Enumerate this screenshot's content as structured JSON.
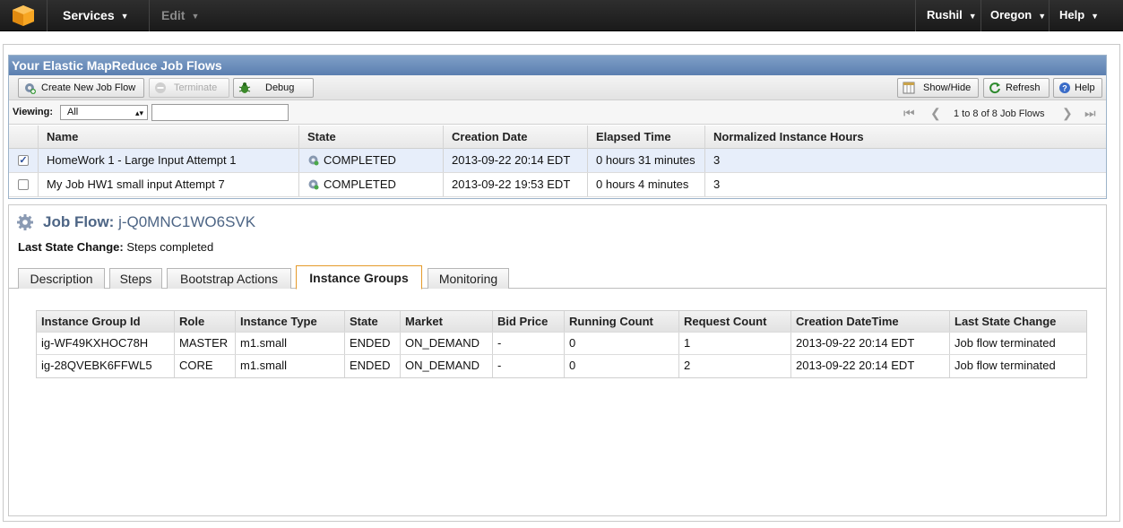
{
  "topnav": {
    "services": "Services",
    "edit": "Edit",
    "user": "Rushil",
    "region": "Oregon",
    "help": "Help"
  },
  "panel": {
    "title": "Your Elastic MapReduce Job Flows"
  },
  "toolbar": {
    "create": "Create New Job Flow",
    "terminate": "Terminate",
    "debug": "Debug",
    "showhide": "Show/Hide",
    "refresh": "Refresh",
    "help": "Help"
  },
  "viewing": {
    "label": "Viewing:",
    "selected": "All",
    "search_value": ""
  },
  "pager": {
    "text": "1 to 8 of 8 Job Flows"
  },
  "jobflows": {
    "columns": [
      "Name",
      "State",
      "Creation Date",
      "Elapsed Time",
      "Normalized Instance Hours"
    ],
    "rows": [
      {
        "checked": true,
        "name": "HomeWork 1 - Large Input Attempt 1",
        "state": "COMPLETED",
        "created": "2013-09-22 20:14 EDT",
        "elapsed": "0 hours 31 minutes",
        "hours": "3"
      },
      {
        "checked": false,
        "name": "My Job HW1 small input Attempt 7",
        "state": "COMPLETED",
        "created": "2013-09-22 19:53 EDT",
        "elapsed": "0 hours 4 minutes",
        "hours": "3"
      }
    ]
  },
  "splitter": "....",
  "detail": {
    "title_prefix": "Job Flow:",
    "jobflow_id": "j-Q0MNC1WO6SVK",
    "lsc_label": "Last State Change:",
    "lsc_value": "Steps completed",
    "tabs": [
      "Description",
      "Steps",
      "Bootstrap Actions",
      "Instance Groups",
      "Monitoring"
    ],
    "active_tab": "Instance Groups"
  },
  "instance_groups": {
    "columns": [
      "Instance Group Id",
      "Role",
      "Instance Type",
      "State",
      "Market",
      "Bid Price",
      "Running Count",
      "Request Count",
      "Creation DateTime",
      "Last State Change"
    ],
    "rows": [
      [
        "ig-WF49KXHOC78H",
        "MASTER",
        "m1.small",
        "ENDED",
        "ON_DEMAND",
        "-",
        "0",
        "1",
        "2013-09-22 20:14 EDT",
        "Job flow terminated"
      ],
      [
        "ig-28QVEBK6FFWL5",
        "CORE",
        "m1.small",
        "ENDED",
        "ON_DEMAND",
        "-",
        "0",
        "2",
        "2013-09-22 20:14 EDT",
        "Job flow terminated"
      ]
    ]
  },
  "colors": {
    "accent_tab": "#e59a2a",
    "panel_title": "#5b7fb0",
    "selected_row": "#e7eefa"
  }
}
